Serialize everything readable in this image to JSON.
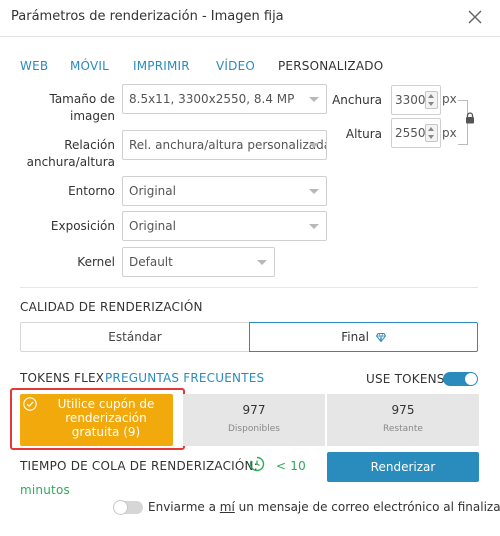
{
  "window": {
    "title": "Parámetros de renderización - Imagen fija"
  },
  "tabs": [
    {
      "label": "WEB",
      "active": false
    },
    {
      "label": "MÓVIL",
      "active": false
    },
    {
      "label": "IMPRIMIR",
      "active": false
    },
    {
      "label": "VÍDEO",
      "active": false
    },
    {
      "label": "PERSONALIZADO",
      "active": true
    }
  ],
  "image_size": {
    "label": "Tamaño de imagen",
    "value": "8.5x11, 3300x2550, 8.4 MP"
  },
  "aspect": {
    "label": "Relación anchura/altura",
    "value": "Rel. anchura/altura personalizada"
  },
  "environment": {
    "label": "Entorno",
    "value": "Original"
  },
  "exposure": {
    "label": "Exposición",
    "value": "Original"
  },
  "kernel": {
    "label": "Kernel",
    "value": "Default"
  },
  "width": {
    "label": "Anchura",
    "value": "3300",
    "unit": "px"
  },
  "height": {
    "label": "Altura",
    "value": "2550"
  },
  "quality": {
    "heading": "CALIDAD DE RENDERIZACIÓN",
    "standard_label": "Estándar",
    "final_label": "Final",
    "selected": "Final"
  },
  "tokens": {
    "heading": "TOKENS FLEX",
    "faq_label": "PREGUNTAS FRECUENTES",
    "use_tokens_label": "USE TOKENS",
    "use_tokens_on": true,
    "coupon_label": "Utilice cupón de renderización gratuita (9)",
    "available_value": "977",
    "available_label": "Disponibles",
    "remaining_value": "975",
    "remaining_label": "Restante"
  },
  "queue": {
    "label": "TIEMPO DE COLA DE RENDERIZACIÓN:",
    "value": "< 10",
    "unit": "minutos"
  },
  "render_button": {
    "label": "Renderizar"
  },
  "email": {
    "text_before": "Enviarme a ",
    "text_emphasis": "mí",
    "text_after": " un mensaje de correo electrónico al finalizar",
    "enabled": false
  },
  "colors": {
    "accent": "#2a8bbd",
    "coupon": "#f2a90b",
    "highlight": "#e53935",
    "stat_bg": "#e6e6e6"
  },
  "icons": [
    "close-icon",
    "caret-down-icon",
    "spin-up-icon",
    "spin-down-icon",
    "lock-icon",
    "diamond-icon",
    "checkmark-icon",
    "clock-icon"
  ]
}
